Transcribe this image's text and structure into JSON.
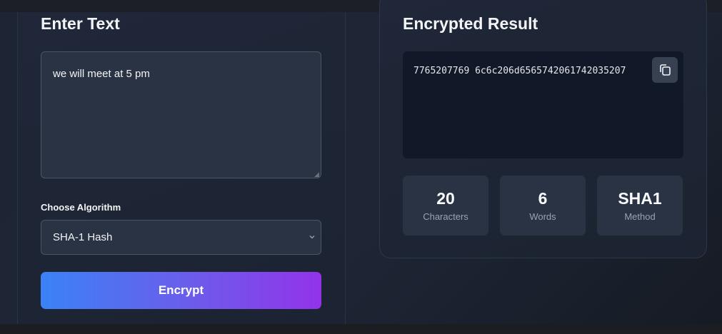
{
  "input_panel": {
    "title": "Enter Text",
    "text_value": "we will meet at 5 pm",
    "algorithm_label": "Choose Algorithm",
    "algorithm_selected": "SHA-1 Hash",
    "encrypt_label": "Encrypt"
  },
  "result_panel": {
    "title": "Encrypted Result",
    "output": "7765207769 6c6c206d6565742061742035207",
    "copy_icon": "copy-icon"
  },
  "stats": [
    {
      "value": "20",
      "label": "Characters"
    },
    {
      "value": "6",
      "label": "Words"
    },
    {
      "value": "SHA1",
      "label": "Method"
    }
  ],
  "colors": {
    "accent_start": "#3b82f6",
    "accent_end": "#9333ea"
  }
}
